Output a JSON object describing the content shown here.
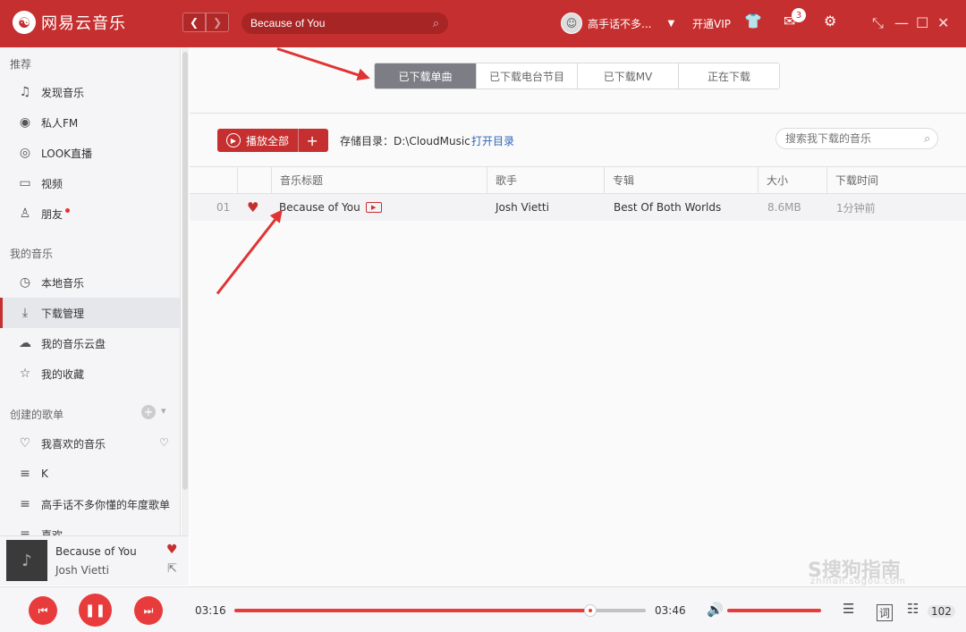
{
  "app": {
    "title": "网易云音乐",
    "logo_glyph": "☯"
  },
  "header": {
    "search_value": "Because of You",
    "username": "高手话不多...",
    "vip_label": "开通VIP",
    "message_count": "3",
    "icons": [
      "skin-icon",
      "mail-icon",
      "settings-icon"
    ]
  },
  "sidebar": {
    "sections": [
      {
        "title": "推荐",
        "items": [
          {
            "label": "发现音乐",
            "icon": "♫"
          },
          {
            "label": "私人FM",
            "icon": "◉"
          },
          {
            "label": "LOOK直播",
            "icon": "◎"
          },
          {
            "label": "视频",
            "icon": "▭"
          },
          {
            "label": "朋友",
            "icon": "♙"
          }
        ]
      },
      {
        "title": "我的音乐",
        "items": [
          {
            "label": "本地音乐",
            "icon": "◷"
          },
          {
            "label": "下载管理",
            "icon": "⤓"
          },
          {
            "label": "我的音乐云盘",
            "icon": "☁"
          },
          {
            "label": "我的收藏",
            "icon": "☆"
          }
        ]
      },
      {
        "title": "创建的歌单",
        "items": [
          {
            "label": "我喜欢的音乐",
            "icon": "♡"
          },
          {
            "label": "K",
            "icon": "≡"
          },
          {
            "label": "高手话不多你懂的年度歌单",
            "icon": "≡"
          },
          {
            "label": "喜欢",
            "icon": "≡"
          }
        ]
      }
    ]
  },
  "mini_player": {
    "title": "Because of You",
    "artist": "Josh Vietti"
  },
  "tabs": [
    {
      "label": "已下载单曲",
      "active": true
    },
    {
      "label": "已下载电台节目",
      "active": false
    },
    {
      "label": "已下载MV",
      "active": false
    },
    {
      "label": "正在下载",
      "active": false
    }
  ],
  "toolbar": {
    "play_all": "播放全部",
    "storage_label": "存储目录：D:\\CloudMusic",
    "open_dir": "打开目录",
    "search_placeholder": "搜索我下载的音乐"
  },
  "table": {
    "columns": [
      "音乐标题",
      "歌手",
      "专辑",
      "大小",
      "下载时间"
    ],
    "rows": [
      {
        "index": "01",
        "title": "Because of You",
        "artist": "Josh Vietti",
        "album": "Best Of Both Worlds",
        "size": "8.6MB",
        "time": "1分钟前",
        "liked": true,
        "has_mv": true
      }
    ]
  },
  "player": {
    "current": "03:16",
    "total": "03:46",
    "progress": 0.865,
    "volume": 1.0,
    "playlist_count": "102",
    "lyric_label": "词"
  },
  "watermark": {
    "text": "S搜狗指南",
    "sub": "zhinan.sogou.com"
  },
  "colors": {
    "brand": "#c62f2f",
    "accent": "#e83c3c",
    "link": "#2f66b8"
  }
}
